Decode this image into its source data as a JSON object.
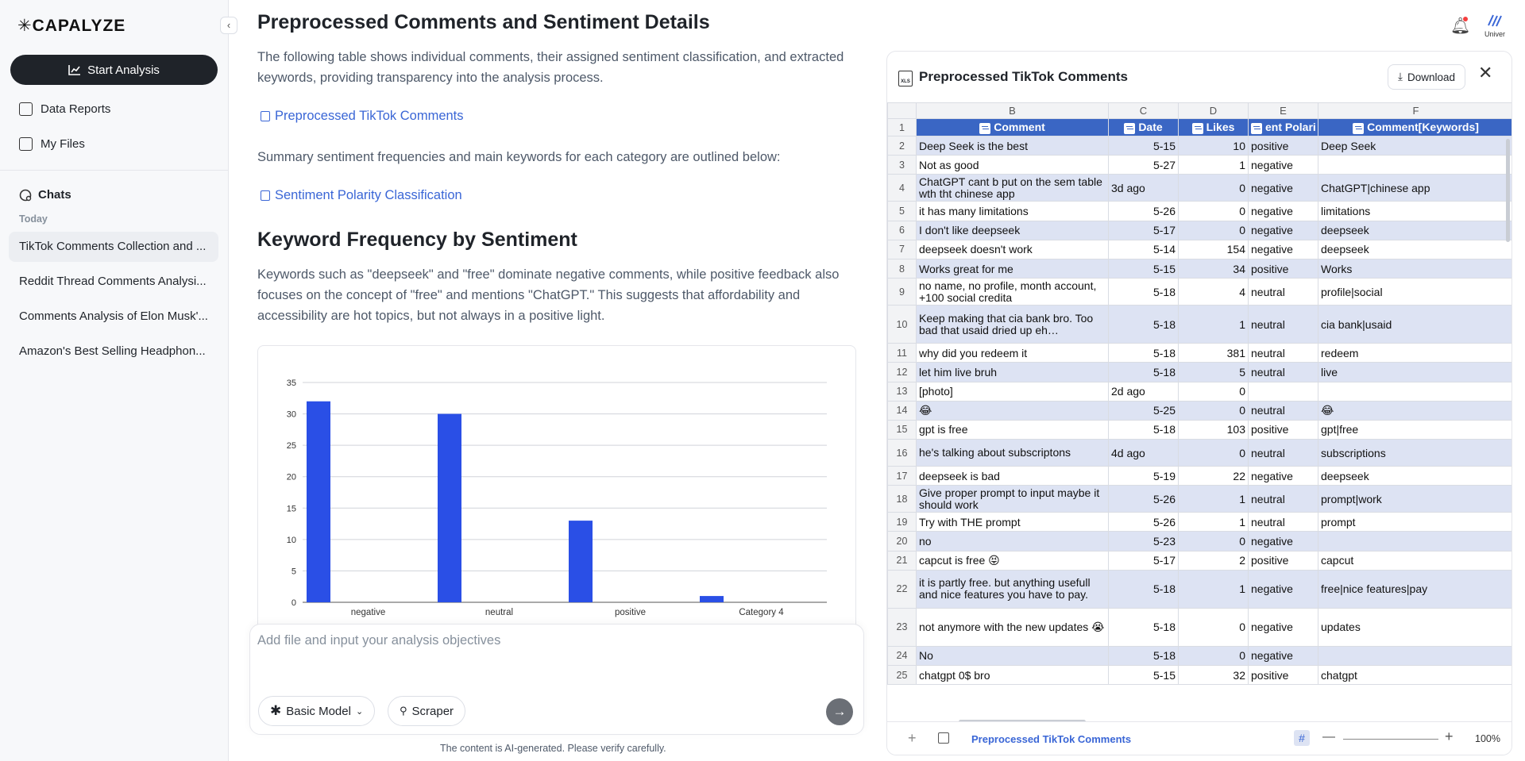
{
  "sidebar": {
    "logo": "✳CAPALYZE",
    "collapse_glyph": "‹",
    "start_label": "Start Analysis",
    "nav": [
      {
        "label": "Data Reports",
        "icon": "clipboard-icon"
      },
      {
        "label": "My Files",
        "icon": "files-icon"
      }
    ],
    "chats_label": "Chats",
    "today_label": "Today",
    "chats": [
      "TikTok Comments Collection and ...",
      "Reddit Thread Comments Analysi...",
      "Comments Analysis of Elon Musk'...",
      "Amazon's Best Selling Headphon..."
    ]
  },
  "main": {
    "title": "Preprocessed Comments and Sentiment Details",
    "intro": "The following table shows individual comments, their assigned sentiment classification, and extracted keywords, providing transparency into the analysis process.",
    "link1": "Preprocessed TikTok Comments",
    "summary": "Summary sentiment frequencies and main keywords for each category are outlined below:",
    "link2": "Sentiment Polarity Classification",
    "section_title": "Keyword Frequency by Sentiment",
    "section_text": "Keywords such as \"deepseek\" and \"free\" dominate negative comments, while positive feedback also focuses on the concept of \"free\" and mentions \"ChatGPT.\" This suggests that affordability and accessibility are hot topics, but not always in a positive light.",
    "input_placeholder": "Add file and input your analysis objectives",
    "model_label": "Basic Model",
    "scraper_label": "Scraper",
    "disclaimer": "The content is AI-generated. Please verify carefully.",
    "send_glyph": "→"
  },
  "chart_data": {
    "type": "bar",
    "categories": [
      "negative",
      "neutral",
      "positive",
      "Category 4"
    ],
    "values": [
      32,
      30,
      13,
      1
    ],
    "yticks": [
      0,
      5,
      10,
      15,
      20,
      25,
      30,
      35
    ],
    "ylim": [
      0,
      35
    ],
    "bar_color": "#2a4fe6",
    "grid": true
  },
  "header": {
    "avatar_label": "Univer"
  },
  "sheet": {
    "title": "Preprocessed TikTok Comments",
    "xls_label": "XLS",
    "download_label": "Download",
    "close_glyph": "✕",
    "col_letters": [
      "B",
      "C",
      "D",
      "E",
      "F"
    ],
    "headers": [
      "Comment",
      "Date",
      "Likes",
      "ent Polari",
      "Comment[Keywords]"
    ],
    "rows": [
      {
        "n": "2",
        "c": "Deep Seek is the best",
        "d": "5-15",
        "l": "10",
        "p": "positive",
        "k": "Deep Seek",
        "shade": true
      },
      {
        "n": "3",
        "c": "Not as good",
        "d": "5-27",
        "l": "1",
        "p": "negative",
        "k": "",
        "shade": false
      },
      {
        "n": "4",
        "c": "ChatGPT cant b put on the sem table wth tht chinese app",
        "d": "3d ago",
        "l": "0",
        "p": "negative",
        "k": "ChatGPT|chinese app",
        "shade": true,
        "tall": true,
        "dleft": true
      },
      {
        "n": "5",
        "c": "it has many limitations",
        "d": "5-26",
        "l": "0",
        "p": "negative",
        "k": "limitations",
        "shade": false
      },
      {
        "n": "6",
        "c": "I don't like deepseek",
        "d": "5-17",
        "l": "0",
        "p": "negative",
        "k": "deepseek",
        "shade": true
      },
      {
        "n": "7",
        "c": "deepseek doesn't work",
        "d": "5-14",
        "l": "154",
        "p": "negative",
        "k": "deepseek",
        "shade": false
      },
      {
        "n": "8",
        "c": "Works great for me",
        "d": "5-15",
        "l": "34",
        "p": "positive",
        "k": "Works",
        "shade": true
      },
      {
        "n": "9",
        "c": "no name, no profile, month account, +100 social credita",
        "d": "5-18",
        "l": "4",
        "p": "neutral",
        "k": "profile|social",
        "shade": false,
        "tall": true
      },
      {
        "n": "10",
        "c": "Keep making that cia bank bro. Too bad that usaid dried up eh…",
        "d": "5-18",
        "l": "1",
        "p": "neutral",
        "k": "cia bank|usaid",
        "shade": true,
        "xtall": true
      },
      {
        "n": "11",
        "c": "why did you redeem it",
        "d": "5-18",
        "l": "381",
        "p": "neutral",
        "k": "redeem",
        "shade": false
      },
      {
        "n": "12",
        "c": "let him live bruh",
        "d": "5-18",
        "l": "5",
        "p": "neutral",
        "k": "live",
        "shade": true
      },
      {
        "n": "13",
        "c": "[photo]",
        "d": "2d ago",
        "l": "0",
        "p": "",
        "k": "",
        "shade": false,
        "dleft": true
      },
      {
        "n": "14",
        "c": "😂",
        "d": "5-25",
        "l": "0",
        "p": "neutral",
        "k": "😂",
        "shade": true
      },
      {
        "n": "15",
        "c": "gpt is free",
        "d": "5-18",
        "l": "103",
        "p": "positive",
        "k": "gpt|free",
        "shade": false
      },
      {
        "n": "16",
        "c": "he's talking about subscriptons",
        "d": "4d ago",
        "l": "0",
        "p": "neutral",
        "k": "subscriptions",
        "shade": true,
        "tall": true,
        "dleft": true
      },
      {
        "n": "17",
        "c": "deepseek is bad",
        "d": "5-19",
        "l": "22",
        "p": "negative",
        "k": "deepseek",
        "shade": false
      },
      {
        "n": "18",
        "c": "Give proper prompt to input maybe it should work",
        "d": "5-26",
        "l": "1",
        "p": "neutral",
        "k": "prompt|work",
        "shade": true,
        "tall": true
      },
      {
        "n": "19",
        "c": "Try with THE prompt",
        "d": "5-26",
        "l": "1",
        "p": "neutral",
        "k": "prompt",
        "shade": false
      },
      {
        "n": "20",
        "c": "no",
        "d": "5-23",
        "l": "0",
        "p": "negative",
        "k": "",
        "shade": true
      },
      {
        "n": "21",
        "c": "capcut is free 😝",
        "d": "5-17",
        "l": "2",
        "p": "positive",
        "k": "capcut",
        "shade": false
      },
      {
        "n": "22",
        "c": "it is partly free. but anything usefull and nice features you have to pay.",
        "d": "5-18",
        "l": "1",
        "p": "negative",
        "k": "free|nice features|pay",
        "shade": true,
        "xtall": true
      },
      {
        "n": "23",
        "c": "not anymore with the new updates 😭",
        "d": "5-18",
        "l": "0",
        "p": "negative",
        "k": "updates",
        "shade": false,
        "xtall": true
      },
      {
        "n": "24",
        "c": "No",
        "d": "5-18",
        "l": "0",
        "p": "negative",
        "k": "",
        "shade": true
      },
      {
        "n": "25",
        "c": "chatgpt 0$ bro",
        "d": "5-15",
        "l": "32",
        "p": "positive",
        "k": "chatgpt",
        "shade": false
      }
    ],
    "tab_label": "Preprocessed TikTok Comments",
    "add_glyph": "+",
    "zoom_minus": "—",
    "zoom_plus": "+",
    "zoom": "100%"
  }
}
